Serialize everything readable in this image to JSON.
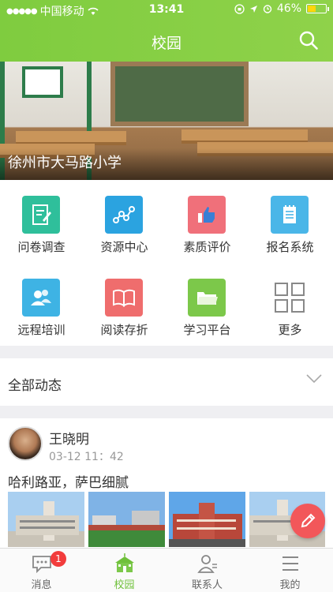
{
  "status": {
    "carrier": "中国移动",
    "time": "13:41",
    "battery": "46%",
    "battery_level": 0.46
  },
  "nav": {
    "title": "校园"
  },
  "banner": {
    "school_name": "徐州市大马路小学"
  },
  "apps": [
    {
      "label": "问卷调查",
      "icon": "survey-icon",
      "color": "#2fbf9b"
    },
    {
      "label": "资源中心",
      "icon": "resource-icon",
      "color": "#2ba3e0"
    },
    {
      "label": "素质评价",
      "icon": "thumbs-up-icon",
      "color": "#f0707a"
    },
    {
      "label": "报名系统",
      "icon": "notepad-icon",
      "color": "#4ab6e8"
    },
    {
      "label": "远程培训",
      "icon": "users-icon",
      "color": "#3eb3e4"
    },
    {
      "label": "阅读存折",
      "icon": "book-icon",
      "color": "#ef6d6d"
    },
    {
      "label": "学习平台",
      "icon": "folder-icon",
      "color": "#7cc84a"
    },
    {
      "label": "更多",
      "icon": "grid-icon",
      "color": "#888888"
    }
  ],
  "section": {
    "title": "全部动态"
  },
  "post": {
    "author": "王晓明",
    "time": "03-12 11：42",
    "text": "哈利路亚，萨巴细腻"
  },
  "tabs": [
    {
      "label": "消息",
      "icon": "message-icon",
      "badge": "1"
    },
    {
      "label": "校园",
      "icon": "school-icon"
    },
    {
      "label": "联系人",
      "icon": "contacts-icon"
    },
    {
      "label": "我的",
      "icon": "menu-icon"
    }
  ]
}
